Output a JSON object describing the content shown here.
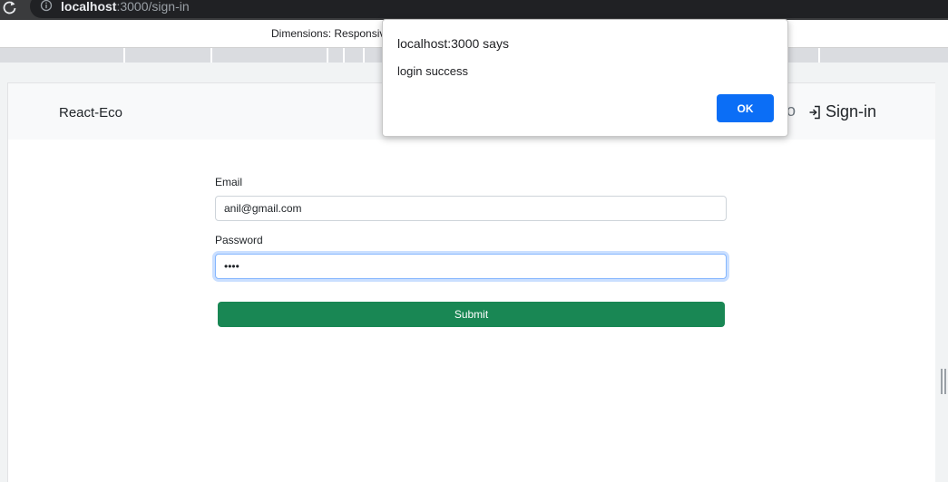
{
  "browser": {
    "url_host": "localhost",
    "url_rest": ":3000/sign-in",
    "icons": {
      "reload": "reload-icon",
      "info": "info-icon"
    }
  },
  "devtools": {
    "dimensions_label": "Dimensions: Responsive"
  },
  "app": {
    "brand": "React-Eco",
    "nav": {
      "partial_item": "o",
      "signin_label": "Sign-in",
      "signin_icon": "sign-in-icon"
    },
    "form": {
      "email_label": "Email",
      "email_value": "anil@gmail.com",
      "password_label": "Password",
      "password_value": "••••",
      "submit_label": "Submit"
    }
  },
  "alert": {
    "title": "localhost:3000 says",
    "message": "login success",
    "ok_label": "OK"
  },
  "colors": {
    "submit_green": "#198754",
    "ok_blue": "#0b6ef6",
    "navbar_bg": "#f8f9fa",
    "chrome_dark": "#3a3b3d"
  }
}
